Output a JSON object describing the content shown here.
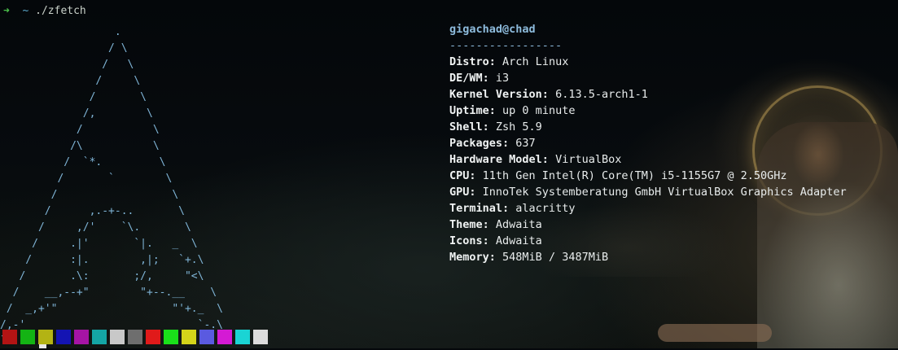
{
  "prompt": {
    "arrow": "➜",
    "cwd": "~",
    "command": "./zfetch"
  },
  "logo": {
    "ascii": "                  .\n                 / \\\n                /   \\\n               /     \\\n              /       \\\n             /,        \\\n            /           \\\n           /\\           \\\n          /  `*.         \\\n         /       `        \\\n        /                  \\\n       /      ,.-+-..       \\\n      /     ,/'    `\\.       \\\n     /     .|'       `|.   _  \\\n    /      :|.        ,|;   `+.\\\n   /       .\\:       ;/,     \"<\\\n  /    __,--+\"        \"+--.__    \\\n /  _,+'\"                  \"'+._  \\\n/,-'                           `-.\\\n`                                  `"
  },
  "info": {
    "header": "gigachad@chad",
    "separator": "-----------------",
    "rows": [
      {
        "key": "Distro",
        "value": "Arch Linux"
      },
      {
        "key": "DE/WM",
        "value": "i3"
      },
      {
        "key": "Kernel Version",
        "value": "6.13.5-arch1-1"
      },
      {
        "key": "Uptime",
        "value": "up 0 minute"
      },
      {
        "key": "Shell",
        "value": "Zsh 5.9"
      },
      {
        "key": "Packages",
        "value": "637"
      },
      {
        "key": "Hardware Model",
        "value": "VirtualBox"
      },
      {
        "key": "CPU",
        "value": "11th Gen Intel(R) Core(TM) i5-1155G7 @ 2.50GHz"
      },
      {
        "key": "GPU",
        "value": "InnoTek Systemberatung GmbH VirtualBox Graphics Adapter"
      },
      {
        "key": "Terminal",
        "value": "alacritty"
      },
      {
        "key": "Theme",
        "value": "Adwaita"
      },
      {
        "key": "Icons",
        "value": "Adwaita"
      },
      {
        "key": "Memory",
        "value": "548MiB / 3487MiB"
      }
    ]
  },
  "palette": [
    "#b31414",
    "#14b314",
    "#b3b314",
    "#1414b3",
    "#a514a5",
    "#14a5a5",
    "#c8c8c8",
    "#6e6e6e",
    "#e01a1a",
    "#1ae01a",
    "#d4d41a",
    "#5a5ae0",
    "#d41ad4",
    "#1ad4d4",
    "#dcdcdc"
  ],
  "colors": {
    "logo": "#7fb4d6",
    "header": "#8dbbdc",
    "prompt_arrow": "#4cc44c",
    "text": "#e8ecec"
  }
}
